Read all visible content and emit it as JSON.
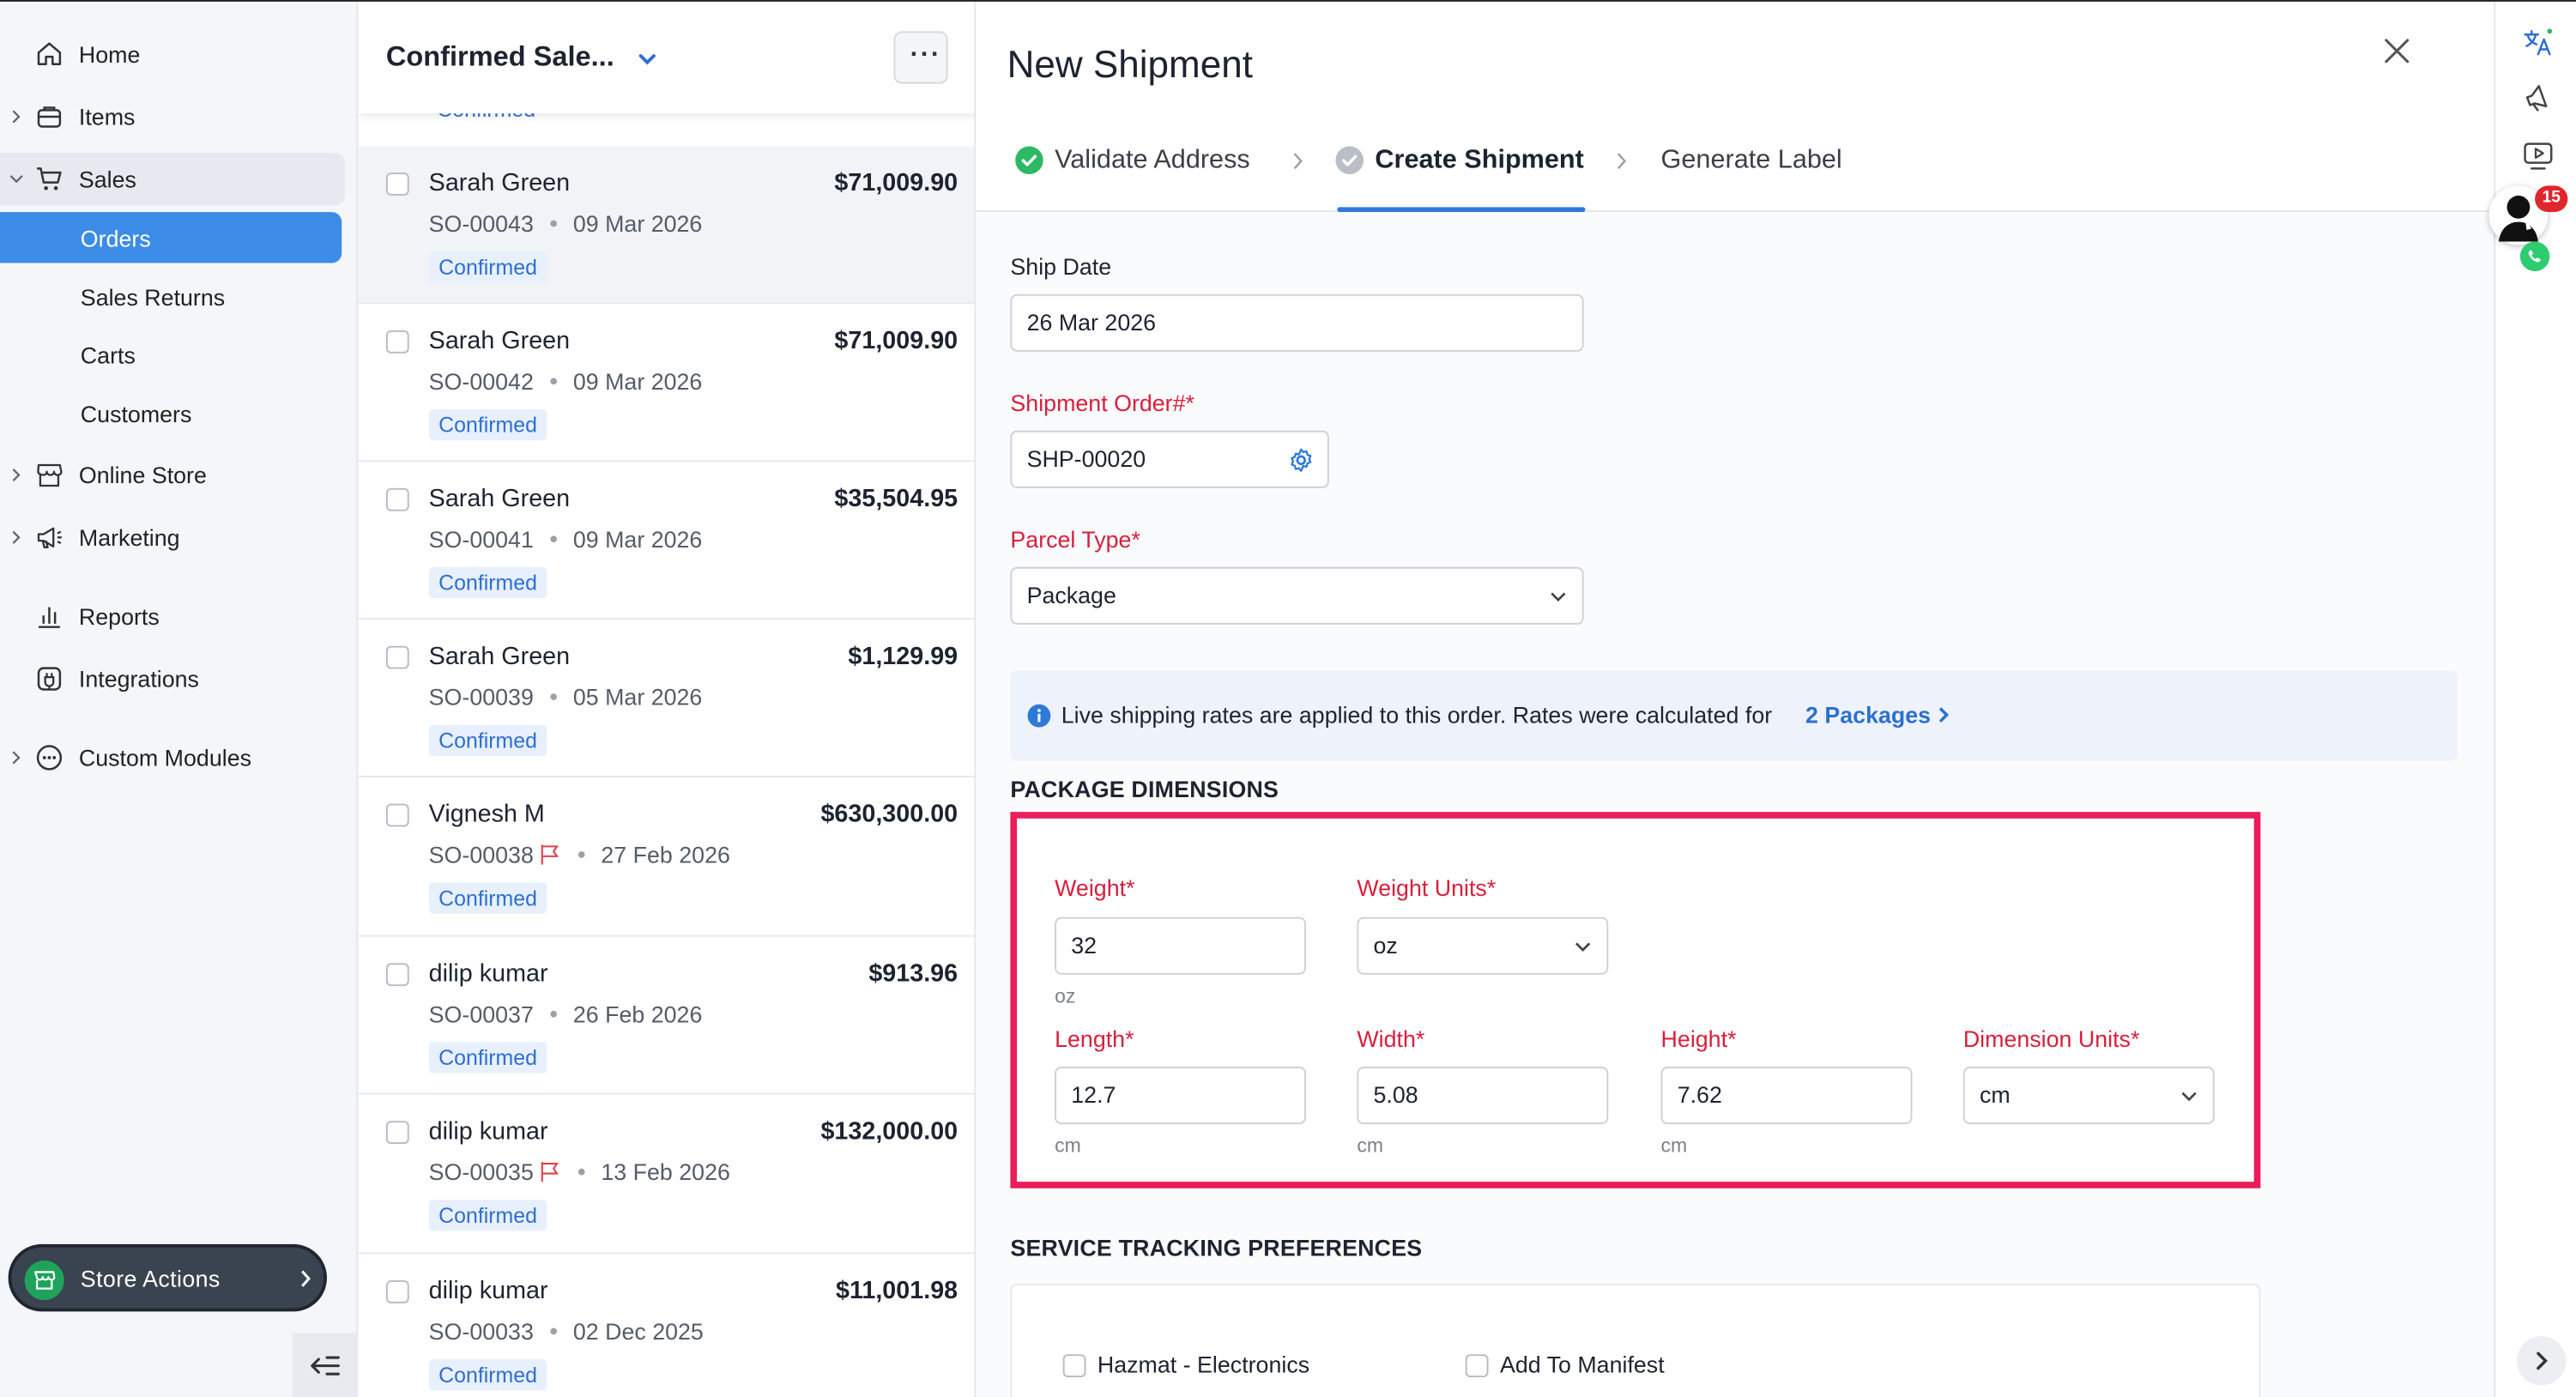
{
  "sidebar": {
    "items": [
      {
        "label": "Home",
        "icon": "home-icon"
      },
      {
        "label": "Items",
        "icon": "items-icon"
      },
      {
        "label": "Sales",
        "icon": "cart-icon"
      },
      {
        "label": "Orders"
      },
      {
        "label": "Sales Returns"
      },
      {
        "label": "Carts"
      },
      {
        "label": "Customers"
      },
      {
        "label": "Online Store",
        "icon": "store-icon"
      },
      {
        "label": "Marketing",
        "icon": "megaphone-icon"
      },
      {
        "label": "Reports",
        "icon": "bar-chart-icon"
      },
      {
        "label": "Integrations",
        "icon": "integrations-icon"
      },
      {
        "label": "Custom Modules",
        "icon": "modules-icon"
      }
    ],
    "store_actions_label": "Store Actions"
  },
  "list": {
    "title": "Confirmed Sale...",
    "peek_text": "Confirmed",
    "rows": [
      {
        "customer": "Sarah Green",
        "amount": "$71,009.90",
        "order": "SO-00043",
        "date": "09 Mar 2026",
        "status": "Confirmed"
      },
      {
        "customer": "Sarah Green",
        "amount": "$71,009.90",
        "order": "SO-00042",
        "date": "09 Mar 2026",
        "status": "Confirmed"
      },
      {
        "customer": "Sarah Green",
        "amount": "$35,504.95",
        "order": "SO-00041",
        "date": "09 Mar 2026",
        "status": "Confirmed"
      },
      {
        "customer": "Sarah Green",
        "amount": "$1,129.99",
        "order": "SO-00039",
        "date": "05 Mar 2026",
        "status": "Confirmed"
      },
      {
        "customer": "Vignesh M",
        "amount": "$630,300.00",
        "order": "SO-00038",
        "date": "27 Feb 2026",
        "status": "Confirmed"
      },
      {
        "customer": "dilip kumar",
        "amount": "$913.96",
        "order": "SO-00037",
        "date": "26 Feb 2026",
        "status": "Confirmed"
      },
      {
        "customer": "dilip kumar",
        "amount": "$132,000.00",
        "order": "SO-00035",
        "date": "13 Feb 2026",
        "status": "Confirmed"
      },
      {
        "customer": "dilip kumar",
        "amount": "$11,001.98",
        "order": "SO-00033",
        "date": "02 Dec 2025",
        "status": "Confirmed"
      }
    ]
  },
  "shipment": {
    "title": "New Shipment",
    "steps": [
      {
        "label": "Validate Address",
        "state": "done"
      },
      {
        "label": "Create Shipment",
        "state": "active"
      },
      {
        "label": "Generate Label",
        "state": "pending"
      }
    ],
    "ship_date_label": "Ship Date",
    "ship_date_value": "26 Mar 2026",
    "order_label": "Shipment Order#*",
    "order_value": "SHP-00020",
    "parcel_label": "Parcel Type*",
    "parcel_value": "Package",
    "info_text": "Live shipping rates are applied to this order. Rates were calculated for",
    "info_link": "2 Packages",
    "dimensions_title": "PACKAGE DIMENSIONS",
    "weight_label": "Weight*",
    "weight_value": "32",
    "weight_unit_hint": "oz",
    "weight_units_label": "Weight Units*",
    "weight_units_value": "oz",
    "length_label": "Length*",
    "length_value": "12.7",
    "width_label": "Width*",
    "width_value": "5.08",
    "height_label": "Height*",
    "height_value": "7.62",
    "dim_unit_hint": "cm",
    "dim_units_label": "Dimension Units*",
    "dim_units_value": "cm",
    "service_title": "SERVICE TRACKING PREFERENCES",
    "hazmat_label": "Hazmat - Electronics",
    "manifest_label": "Add To Manifest"
  },
  "rail": {
    "notification_count": "15"
  },
  "colors": {
    "accent": "#3c8ce7",
    "required": "#d6203d",
    "highlight": "#ea1f5a",
    "success": "#2fb864"
  }
}
